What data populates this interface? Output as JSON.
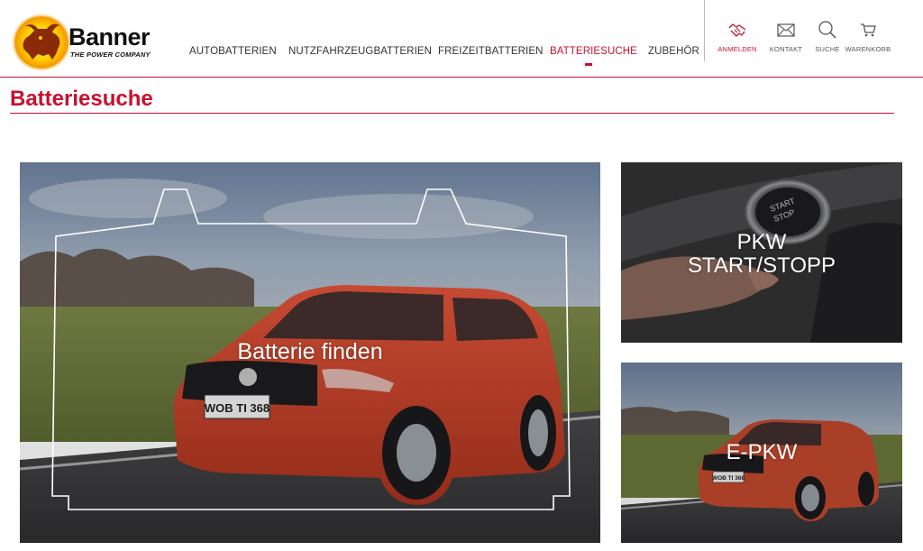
{
  "brand": {
    "name": "Banner",
    "tagline": "THE POWER COMPANY"
  },
  "nav": [
    {
      "label": "AUTOBATTERIEN",
      "active": false
    },
    {
      "label": "NUTZFAHRZEUGBATTERIEN",
      "active": false
    },
    {
      "label": "FREIZEITBATTERIEN",
      "active": false
    },
    {
      "label": "BATTERIESUCHE",
      "active": true
    },
    {
      "label": "ZUBEHÖR",
      "active": false
    }
  ],
  "utility": [
    {
      "label": "ANMELDEN",
      "icon": "handshake-icon"
    },
    {
      "label": "KONTAKT",
      "icon": "envelope-icon"
    },
    {
      "label": "SUCHE",
      "icon": "search-icon"
    },
    {
      "label": "WARENKORB",
      "icon": "cart-icon"
    }
  ],
  "page_title": "Batteriesuche",
  "tiles": {
    "main": {
      "label": "Batterie finden",
      "plate": "WOB TI 368"
    },
    "pkw": {
      "label_line1": "PKW",
      "label_line2": "START/STOPP",
      "button_text1": "START",
      "button_text2": "STOP"
    },
    "epkw": {
      "label": "E-PKW",
      "plate": "WOB TI 368"
    }
  },
  "colors": {
    "accent": "#c8102e",
    "text": "#333333"
  }
}
